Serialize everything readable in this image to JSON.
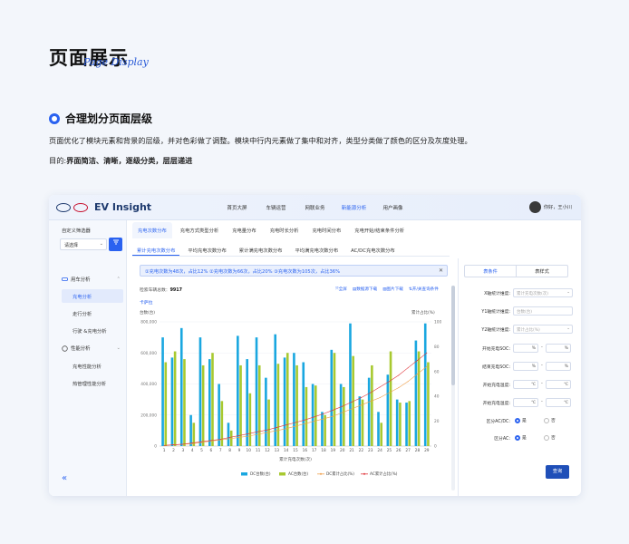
{
  "page": {
    "title": "页面展示",
    "subtitle": "Page Display",
    "section_title": "合理划分页面层级",
    "description": "页面优化了模块元素和背景的层级，并对色彩做了调整。模块中行内元素做了集中和对齐，类型分类做了颜色的区分及灰度处理。",
    "goal_prefix": "目的:",
    "goal_text": "界面简洁、清晰，逐级分类，层层递进"
  },
  "app": {
    "brand": "EV Insight",
    "nav": [
      "首页大屏",
      "车辆运营",
      "网联业务",
      "新能源分析",
      "用户画像"
    ],
    "nav_active": 3,
    "user": "你好，王小川"
  },
  "sidebar": {
    "filter_label": "自定义筛选器",
    "select_placeholder": "请选择",
    "group1": "用车分析",
    "group1_items": [
      "充电分析",
      "走行分析",
      "行驶 &充电分析"
    ],
    "group2": "性能分析",
    "group2_items": [
      "充电性能分析",
      "热管理性能分析"
    ],
    "collapse_icon": "«"
  },
  "tabs1": [
    "充电次数分布",
    "充电方式类型分析",
    "充电量分布",
    "充电时长分析",
    "充电时间分布",
    "充电开始/结束条件分析"
  ],
  "tabs2": [
    "累计充电次数分布",
    "平均充电次数分布",
    "累计满充电次数分布",
    "平均满充电次数分布",
    "AC/DC充电次数分布"
  ],
  "info_text": "①充电次数为48次，占比12% ②充电次数为66次，占比20% ③充电次数为105次，占比36%",
  "total_label": "检索车辆总数：",
  "total_value": "9917",
  "actions": [
    "⤧全屏",
    "▤数据源下载",
    "▨图片下载",
    "⇅开/关查询条件"
  ],
  "expand_label": "卡萨拉",
  "chart_data": {
    "type": "bar",
    "x_title": "累计充电次数(次)",
    "y_left_title": "台数(台)",
    "y_right_title": "累计占比(%)",
    "y_left_ticks": [
      "800,000",
      "600,000",
      "400,000",
      "200,000",
      "0"
    ],
    "y_right_ticks": [
      "100",
      "80",
      "60",
      "40",
      "20",
      "0"
    ],
    "ylim_left": [
      0,
      800000
    ],
    "ylim_right": [
      0,
      100
    ],
    "categories": [
      "1",
      "2",
      "3",
      "4",
      "5",
      "6",
      "7",
      "8",
      "9",
      "10",
      "11",
      "12",
      "13",
      "14",
      "15",
      "16",
      "17",
      "18",
      "19",
      "20",
      "21",
      "22",
      "23",
      "24",
      "25",
      "26",
      "27",
      "28",
      "29"
    ],
    "series": [
      {
        "name": "DC台数(台)",
        "type": "bar",
        "color": "#1aa7e0",
        "values": [
          700000,
          570000,
          760000,
          200000,
          700000,
          560000,
          400000,
          150000,
          710000,
          560000,
          700000,
          440000,
          720000,
          570000,
          600000,
          540000,
          400000,
          220000,
          620000,
          400000,
          790000,
          320000,
          440000,
          220000,
          460000,
          300000,
          280000,
          680000,
          790000
        ]
      },
      {
        "name": "AC台数(台)",
        "type": "bar",
        "color": "#a8c930",
        "values": [
          540000,
          610000,
          560000,
          150000,
          520000,
          600000,
          290000,
          100000,
          520000,
          340000,
          520000,
          300000,
          530000,
          600000,
          520000,
          380000,
          390000,
          200000,
          600000,
          380000,
          580000,
          300000,
          520000,
          150000,
          610000,
          280000,
          290000,
          610000,
          540000
        ]
      },
      {
        "name": "DC累计占比(%)",
        "type": "line",
        "color": "#f0a04b",
        "values": [
          0.5,
          1,
          1.5,
          2,
          3,
          4,
          5,
          6,
          7,
          8,
          9.5,
          11,
          12.5,
          14,
          16,
          18,
          20,
          22,
          24,
          27,
          30,
          33,
          36,
          39,
          43,
          47,
          52,
          58,
          64
        ]
      },
      {
        "name": "AC累计占比(%)",
        "type": "line",
        "color": "#e0353a",
        "values": [
          0.5,
          1,
          1.5,
          2.5,
          3.5,
          4.5,
          5.5,
          7,
          8.5,
          10,
          11.5,
          13,
          15,
          17,
          19,
          21,
          23.5,
          26,
          29,
          32,
          35.5,
          39,
          43,
          47.5,
          52,
          57,
          63,
          69,
          75
        ]
      }
    ]
  },
  "rpanel": {
    "tabs": [
      "表条件",
      "表样式"
    ],
    "placeholder_dim": "累计充电次数(次)",
    "placeholder_unit": "台数(台)",
    "placeholder_pct": "累计占比(%)",
    "x_dim_label": "X轴统计维度:",
    "y1_dim_label": "Y1轴统计维度:",
    "y2_dim_label": "Y2轴统计维度:",
    "soc_start_label": "开始充电SOC:",
    "soc_end_label": "结束充电SOC:",
    "temp_start_label": "开始充电温度:",
    "temp_end_label": "开始充电温度:",
    "acdc_label": "区分AC/DC:",
    "ac_label": "区分AC:",
    "yes": "是",
    "no": "否",
    "pct_unit": "%",
    "temp_unit": "℃",
    "dash": "-",
    "query": "查询"
  }
}
